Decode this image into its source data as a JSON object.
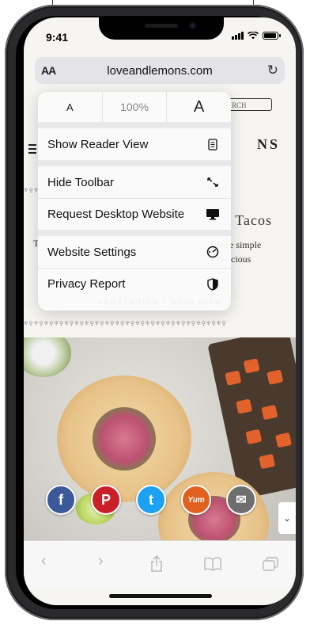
{
  "status": {
    "time": "9:41"
  },
  "address_bar": {
    "aa": "AA",
    "url": "loveandlemons.com"
  },
  "page_menu": {
    "font_smaller": "A",
    "zoom": "100%",
    "font_larger": "A",
    "items": [
      {
        "label": "Show Reader View",
        "icon": "reader-icon"
      },
      {
        "label": "Hide Toolbar",
        "icon": "collapse-arrows-icon"
      },
      {
        "label": "Request Desktop Website",
        "icon": "desktop-icon"
      },
      {
        "label": "Website Settings",
        "icon": "settings-gauge-icon"
      },
      {
        "label": "Privacy Report",
        "icon": "shield-icon"
      }
    ]
  },
  "webpage": {
    "search_frag": "RCH",
    "logo_frag": "NS",
    "title_frag": "Tacos",
    "body_frag_1": "hese simple",
    "body_frag_2": "delicious",
    "t_frag": "T",
    "category": "VEGETARIAN / MAIN DISH",
    "share_buttons": [
      {
        "label": "f",
        "icon": "facebook-icon",
        "color": "#3b5998"
      },
      {
        "label": "P",
        "icon": "pinterest-icon",
        "color": "#cb2027"
      },
      {
        "label": "t",
        "icon": "twitter-icon",
        "color": "#1da1f2"
      },
      {
        "label": "Yum",
        "icon": "yummly-icon",
        "color": "#e16120"
      },
      {
        "label": "✉",
        "icon": "email-icon",
        "color": "#6e6e6e"
      }
    ]
  },
  "toolbar": {
    "back": "back-icon",
    "forward": "forward-icon",
    "share": "share-icon",
    "bookmarks": "bookmarks-icon",
    "tabs": "tabs-icon"
  }
}
